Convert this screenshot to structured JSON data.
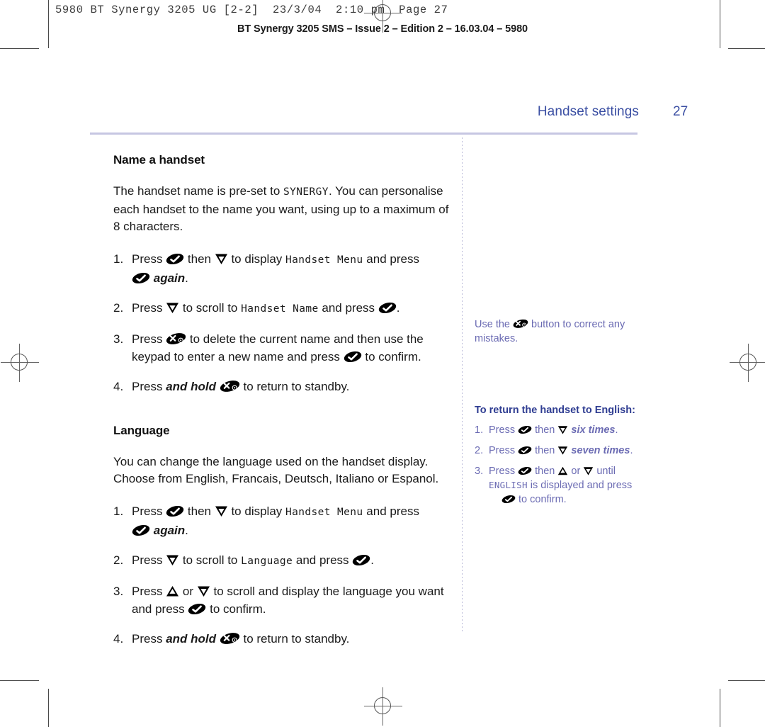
{
  "print_marks": {
    "job_slug": "5980 BT Synergy 3205 UG [2-2]  23/3/04  2:10 pm  Page 27",
    "running_head": "BT Synergy 3205 SMS – Issue 2 – Edition 2 – 16.03.04 – 5980"
  },
  "header": {
    "chapter": "Handset settings",
    "folio": "27",
    "rule_color": "#c6c6e2",
    "text_color": "#3b4fa3"
  },
  "icons": {
    "ok": "ok-key-icon",
    "cancel": "cancel-key-icon",
    "up": "up-arrow-key-icon",
    "down": "down-arrow-key-icon"
  },
  "main": {
    "sections": [
      {
        "id": "name-a-handset",
        "heading": "Name a handset",
        "intro_parts": {
          "a": "The handset name is pre-set to ",
          "lcd": "SYNERGY",
          "b": ". You can personalise each handset to the name you want, using up to a maximum of 8 characters."
        },
        "steps": [
          {
            "num": "1.",
            "p1": "Press ",
            "p2": " then ",
            "p3": " to display ",
            "lcd": "Handset Menu",
            "p4": " and press ",
            "p5": " ",
            "em": "again",
            "p6": "."
          },
          {
            "num": "2.",
            "p1": "Press ",
            "p2": " to scroll to ",
            "lcd": "Handset Name",
            "p3": " and press ",
            "p4": "."
          },
          {
            "num": "3.",
            "p1": "Press ",
            "p2": " to delete the current name and then use the keypad to enter a new name and press ",
            "p3": " to confirm."
          },
          {
            "num": "4.",
            "p1": "Press ",
            "em": "and hold",
            "p2": " ",
            "p3": " to return to standby."
          }
        ]
      },
      {
        "id": "language",
        "heading": "Language",
        "intro_parts": {
          "a": "You can change the language used on the handset display. Choose from English, Francais, Deutsch, Italiano or Espanol.",
          "lcd": "",
          "b": ""
        },
        "steps": [
          {
            "num": "1.",
            "p1": "Press ",
            "p2": " then ",
            "p3": " to display ",
            "lcd": "Handset Menu",
            "p4": " and press ",
            "p5": " ",
            "em": "again",
            "p6": "."
          },
          {
            "num": "2.",
            "p1": "Press ",
            "p2": " to scroll to ",
            "lcd": "Language",
            "p3": " and press ",
            "p4": "."
          },
          {
            "num": "3.",
            "p1": "Press ",
            "p2": " or ",
            "p3": " to scroll and display the language you want and press ",
            "p4": " to confirm."
          },
          {
            "num": "4.",
            "p1": "Press ",
            "em": "and hold",
            "p2": " ",
            "p3": " to return to standby."
          }
        ]
      }
    ]
  },
  "sidebar": {
    "note": {
      "p1": "Use the ",
      "p2": " button to correct any mistakes.",
      "color": "#6b6bb3"
    },
    "english_block": {
      "title": "To return the handset to English:",
      "title_color": "#2f3d92",
      "steps": [
        {
          "num": "1.",
          "p1": "Press ",
          "p2": " then ",
          "em": " six times",
          "p3": "."
        },
        {
          "num": "2.",
          "p1": "Press ",
          "p2": " then ",
          "em": " seven times",
          "p3": "."
        },
        {
          "num": "3.",
          "p1": "Press ",
          "p2": " then ",
          "p3": " or ",
          "p4": " until ",
          "lcd": "ENGLISH",
          "p5": " is displayed and press ",
          "p6": " to confirm."
        }
      ]
    }
  }
}
